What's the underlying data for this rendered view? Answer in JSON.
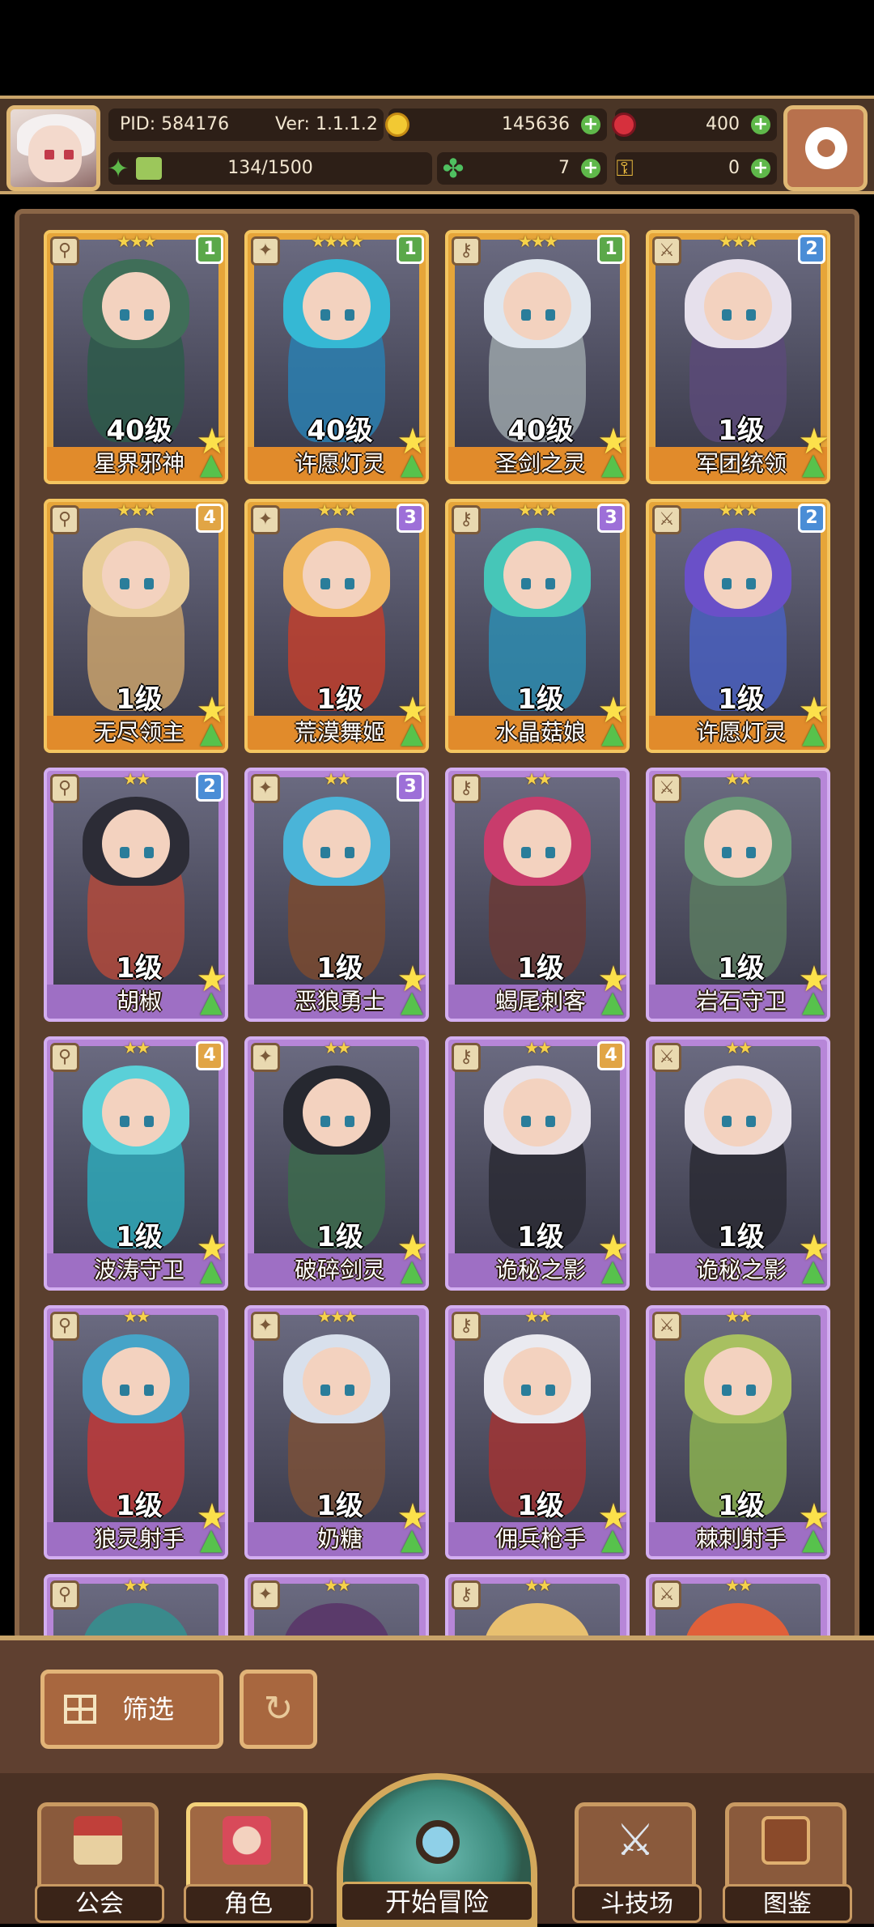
{
  "header": {
    "pid": "PID: 584176",
    "version": "Ver: 1.1.1.2",
    "gold": "145636",
    "gems": "400",
    "xp": "134/1500",
    "xp_fraction": 0.089,
    "clovers": "7",
    "keys": "0"
  },
  "colors": {
    "gold_card": "#e6a539",
    "purple_card": "#b786d8",
    "panel": "#5a3f2e"
  },
  "cards": [
    {
      "name": "星界邪神",
      "level": "40级",
      "stars": "★★★",
      "badge": "1",
      "rarity": "gold",
      "hair": "#3f6e58",
      "body": "#2d5a4a"
    },
    {
      "name": "许愿灯灵",
      "level": "40级",
      "stars": "★★★★",
      "badge": "1",
      "rarity": "gold",
      "hair": "#35b8d4",
      "body": "#2a7fb0"
    },
    {
      "name": "圣剑之灵",
      "level": "40级",
      "stars": "★★★",
      "badge": "1",
      "rarity": "gold",
      "hair": "#dfe6ee",
      "body": "#9aa3a8"
    },
    {
      "name": "军团统领",
      "level": "1级",
      "stars": "★★★",
      "badge": "2",
      "rarity": "gold",
      "hair": "#e6e0ec",
      "body": "#5a4a78"
    },
    {
      "name": "无尽领主",
      "level": "1级",
      "stars": "★★★",
      "badge": "4",
      "rarity": "gold",
      "hair": "#e8cd98",
      "body": "#c9a26c"
    },
    {
      "name": "荒漠舞姬",
      "level": "1级",
      "stars": "★★★",
      "badge": "3",
      "rarity": "gold",
      "hair": "#f0b860",
      "body": "#c0402e"
    },
    {
      "name": "水晶菇娘",
      "level": "1级",
      "stars": "★★★",
      "badge": "3",
      "rarity": "gold",
      "hair": "#46c6b8",
      "body": "#2e8cb0"
    },
    {
      "name": "许愿灯灵",
      "level": "1级",
      "stars": "★★★",
      "badge": "2",
      "rarity": "gold",
      "hair": "#6a50c8",
      "body": "#4a60c0"
    },
    {
      "name": "胡椒",
      "level": "1级",
      "stars": "★★",
      "badge": "2",
      "rarity": "purple",
      "hair": "#2c2c36",
      "body": "#b24a3c"
    },
    {
      "name": "恶狼勇士",
      "level": "1级",
      "stars": "★★",
      "badge": "3",
      "rarity": "purple",
      "hair": "#4ab4d8",
      "body": "#7a4a30"
    },
    {
      "name": "蝎尾刺客",
      "level": "1级",
      "stars": "★★",
      "badge": "",
      "rarity": "purple",
      "hair": "#c83c6c",
      "body": "#6a3a36"
    },
    {
      "name": "岩石守卫",
      "level": "1级",
      "stars": "★★",
      "badge": "",
      "rarity": "purple",
      "hair": "#6a9a78",
      "body": "#5a7a60"
    },
    {
      "name": "波涛守卫",
      "level": "1级",
      "stars": "★★",
      "badge": "4",
      "rarity": "purple",
      "hair": "#5ad0d8",
      "body": "#2ea8b8"
    },
    {
      "name": "破碎剑灵",
      "level": "1级",
      "stars": "★★",
      "badge": "",
      "rarity": "purple",
      "hair": "#262830",
      "body": "#3c6a4c"
    },
    {
      "name": "诡秘之影",
      "level": "1级",
      "stars": "★★",
      "badge": "4",
      "rarity": "purple",
      "hair": "#e8e4ec",
      "body": "#2a2a34"
    },
    {
      "name": "诡秘之影",
      "level": "1级",
      "stars": "★★",
      "badge": "",
      "rarity": "purple",
      "hair": "#e8e4ec",
      "body": "#2a2a34"
    },
    {
      "name": "狼灵射手",
      "level": "1级",
      "stars": "★★",
      "badge": "",
      "rarity": "purple",
      "hair": "#46a4c8",
      "body": "#c03a3a"
    },
    {
      "name": "奶糖",
      "level": "1级",
      "stars": "★★★",
      "badge": "",
      "rarity": "purple",
      "hair": "#d8e0ec",
      "body": "#7a5038"
    },
    {
      "name": "佣兵枪手",
      "level": "1级",
      "stars": "★★",
      "badge": "",
      "rarity": "purple",
      "hair": "#eaeaf0",
      "body": "#a03434"
    },
    {
      "name": "棘刺射手",
      "level": "1级",
      "stars": "★★",
      "badge": "",
      "rarity": "purple",
      "hair": "#a8c060",
      "body": "#8ab050"
    }
  ],
  "partial_cards": [
    {
      "stars": "★★",
      "rarity": "purple",
      "hair": "#3a8a8c"
    },
    {
      "stars": "★★",
      "rarity": "purple",
      "hair": "#5a3a6a"
    },
    {
      "stars": "★★",
      "rarity": "purple",
      "hair": "#e8c070"
    },
    {
      "stars": "★★",
      "rarity": "purple",
      "hair": "#e0603a"
    }
  ],
  "controls": {
    "filter_label": "筛选"
  },
  "nav": {
    "guild": "公会",
    "characters": "角色",
    "adventure": "开始冒险",
    "arena": "斗技场",
    "codex": "图鉴"
  }
}
